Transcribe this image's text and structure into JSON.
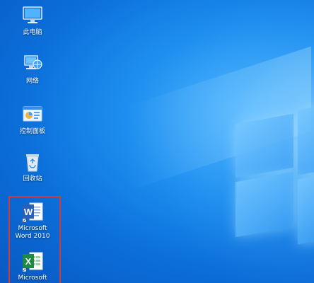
{
  "desktop": {
    "icons": [
      {
        "label": "此电脑",
        "icon": "this-pc-icon"
      },
      {
        "label": "网络",
        "icon": "network-icon"
      },
      {
        "label": "控制面板",
        "icon": "control-panel-icon"
      },
      {
        "label": "回收站",
        "icon": "recycle-bin-icon"
      },
      {
        "label": "Microsoft\nWord 2010",
        "icon": "word-icon"
      },
      {
        "label": "Microsoft",
        "icon": "excel-icon"
      }
    ],
    "selection_highlight_color": "#d23a3a",
    "accent": "#0b6fda"
  }
}
